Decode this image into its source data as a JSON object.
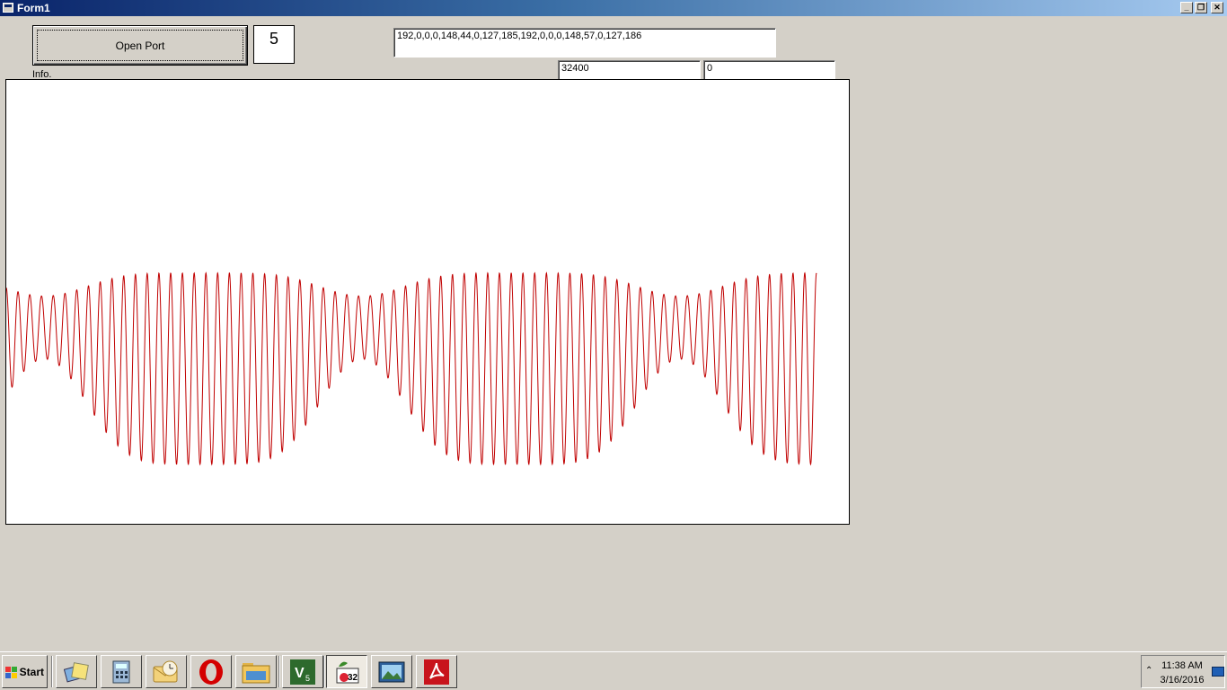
{
  "window": {
    "title": "Form1",
    "minimize_icon": "minimize-icon",
    "restore_icon": "restore-icon",
    "close_icon": "close-icon"
  },
  "form": {
    "open_port_label": "Open Port",
    "count_value": "5",
    "data_line": "192,0,0,0,148,44,0,127,185,192,0,0,0,148,57,0,127,186",
    "value_box_1": "32400",
    "value_box_2": "0",
    "info_label": "Info."
  },
  "plot": {
    "line_color": "#c00000",
    "cycles": 69,
    "top_level": 0.435,
    "bottom_level": 0.866
  },
  "taskbar": {
    "start_label": "Start",
    "apps": [
      {
        "name": "show-desktop-icon"
      },
      {
        "name": "calculator-icon"
      },
      {
        "name": "outlook-icon"
      },
      {
        "name": "opera-icon"
      },
      {
        "name": "file-manager-icon"
      },
      {
        "name": "v5-app-icon"
      },
      {
        "name": "form-app-icon"
      },
      {
        "name": "image-viewer-icon"
      },
      {
        "name": "acrobat-icon"
      }
    ],
    "clock_time": "11:38 AM",
    "clock_date": "3/16/2016"
  }
}
